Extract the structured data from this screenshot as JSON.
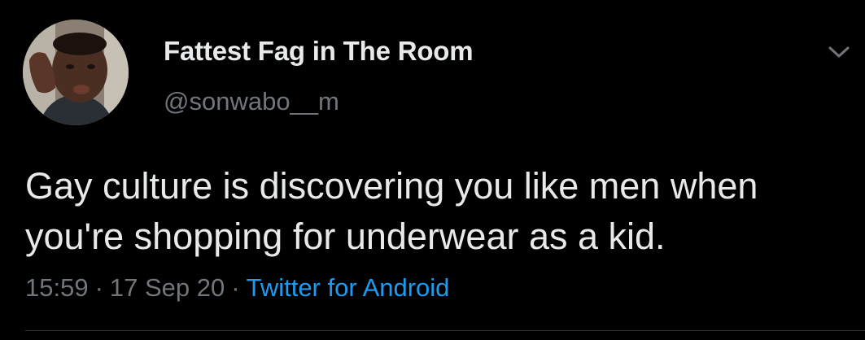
{
  "tweet": {
    "author": {
      "display_name": "Fattest Fag in The Room",
      "handle": "@sonwabo__m",
      "avatar_icon": "profile-photo"
    },
    "text_lines": [
      "Gay culture is discovering you like men when",
      "you're shopping for underwear as a kid."
    ],
    "time": "15:59",
    "date": "17 Sep 20",
    "separator": "·",
    "source": "Twitter for Android",
    "more_icon": "chevron-down-icon"
  },
  "colors": {
    "background": "#000000",
    "text": "#e7e9ea",
    "secondary_text": "#71767b",
    "link": "#1d9bf0",
    "divider": "#2f3336"
  }
}
